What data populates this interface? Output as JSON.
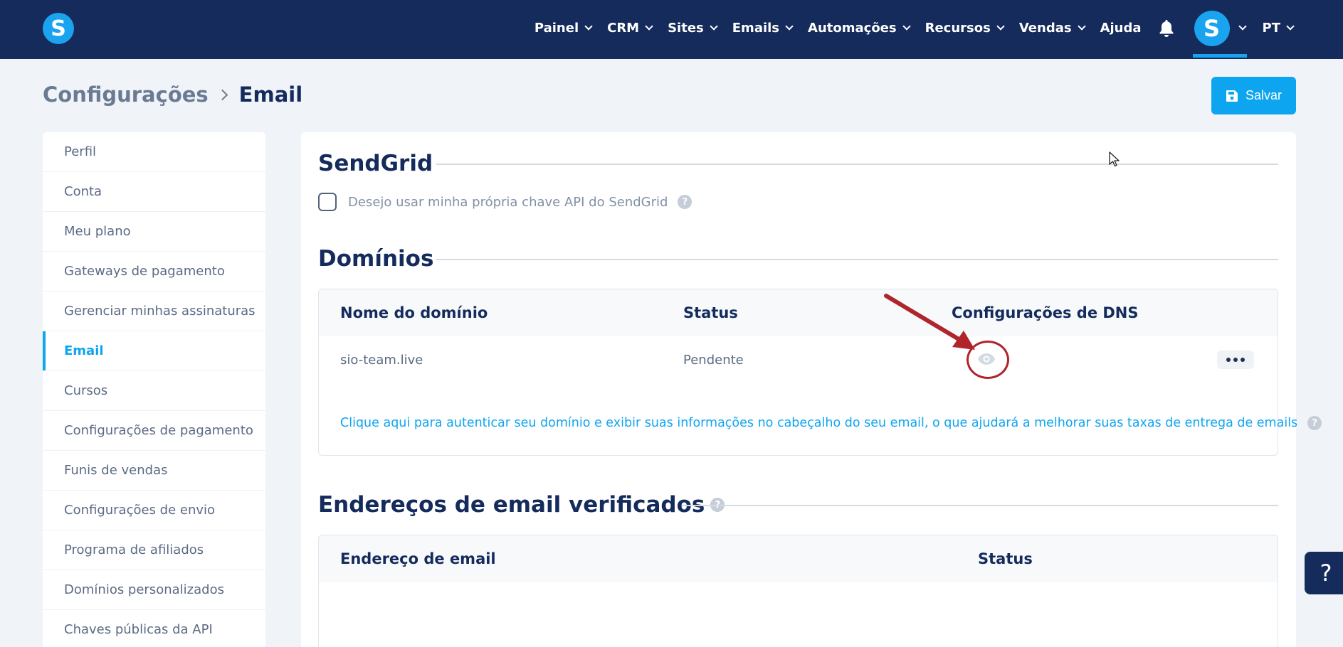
{
  "nav": {
    "logo_letter": "S",
    "items": [
      {
        "label": "Painel",
        "dropdown": true
      },
      {
        "label": "CRM",
        "dropdown": true
      },
      {
        "label": "Sites",
        "dropdown": true
      },
      {
        "label": "Emails",
        "dropdown": true
      },
      {
        "label": "Automações",
        "dropdown": true
      },
      {
        "label": "Recursos",
        "dropdown": true
      },
      {
        "label": "Vendas",
        "dropdown": true
      },
      {
        "label": "Ajuda",
        "dropdown": false
      }
    ],
    "avatar_letter": "S",
    "language": "PT",
    "icons": [
      "bell-icon",
      "chevron-down-icon"
    ]
  },
  "header": {
    "breadcrumb_parent": "Configurações",
    "breadcrumb_current": "Email",
    "save_label": "Salvar"
  },
  "sidebar": {
    "items": [
      {
        "label": "Perfil"
      },
      {
        "label": "Conta"
      },
      {
        "label": "Meu plano"
      },
      {
        "label": "Gateways de pagamento"
      },
      {
        "label": "Gerenciar minhas assinaturas"
      },
      {
        "label": "Email",
        "active": true
      },
      {
        "label": "Cursos"
      },
      {
        "label": "Configurações de pagamento"
      },
      {
        "label": "Funis de vendas"
      },
      {
        "label": "Configurações de envio"
      },
      {
        "label": "Programa de afiliados"
      },
      {
        "label": "Domínios personalizados"
      },
      {
        "label": "Chaves públicas da API"
      }
    ]
  },
  "sendgrid": {
    "title": "SendGrid",
    "checkbox_label": "Desejo usar minha própria chave API do SendGrid",
    "checked": false,
    "help": "?"
  },
  "domains": {
    "title": "Domínios",
    "columns": [
      "Nome do domínio",
      "Status",
      "Configurações de DNS"
    ],
    "rows": [
      {
        "domain": "sio-team.live",
        "status": "Pendente"
      }
    ],
    "auth_link": "Clique aqui para autenticar seu domínio e exibir suas informações no cabeçalho do seu email, o que ajudará a melhorar suas taxas de entrega de emails",
    "help": "?"
  },
  "verified": {
    "title": "Endereços de email verificados",
    "help": "?",
    "columns": [
      "Endereço de email",
      "Status"
    ]
  },
  "help_button": "?",
  "colors": {
    "nav_bg": "#142b5c",
    "accent": "#0ea5f0",
    "annotation": "#b0242c"
  }
}
